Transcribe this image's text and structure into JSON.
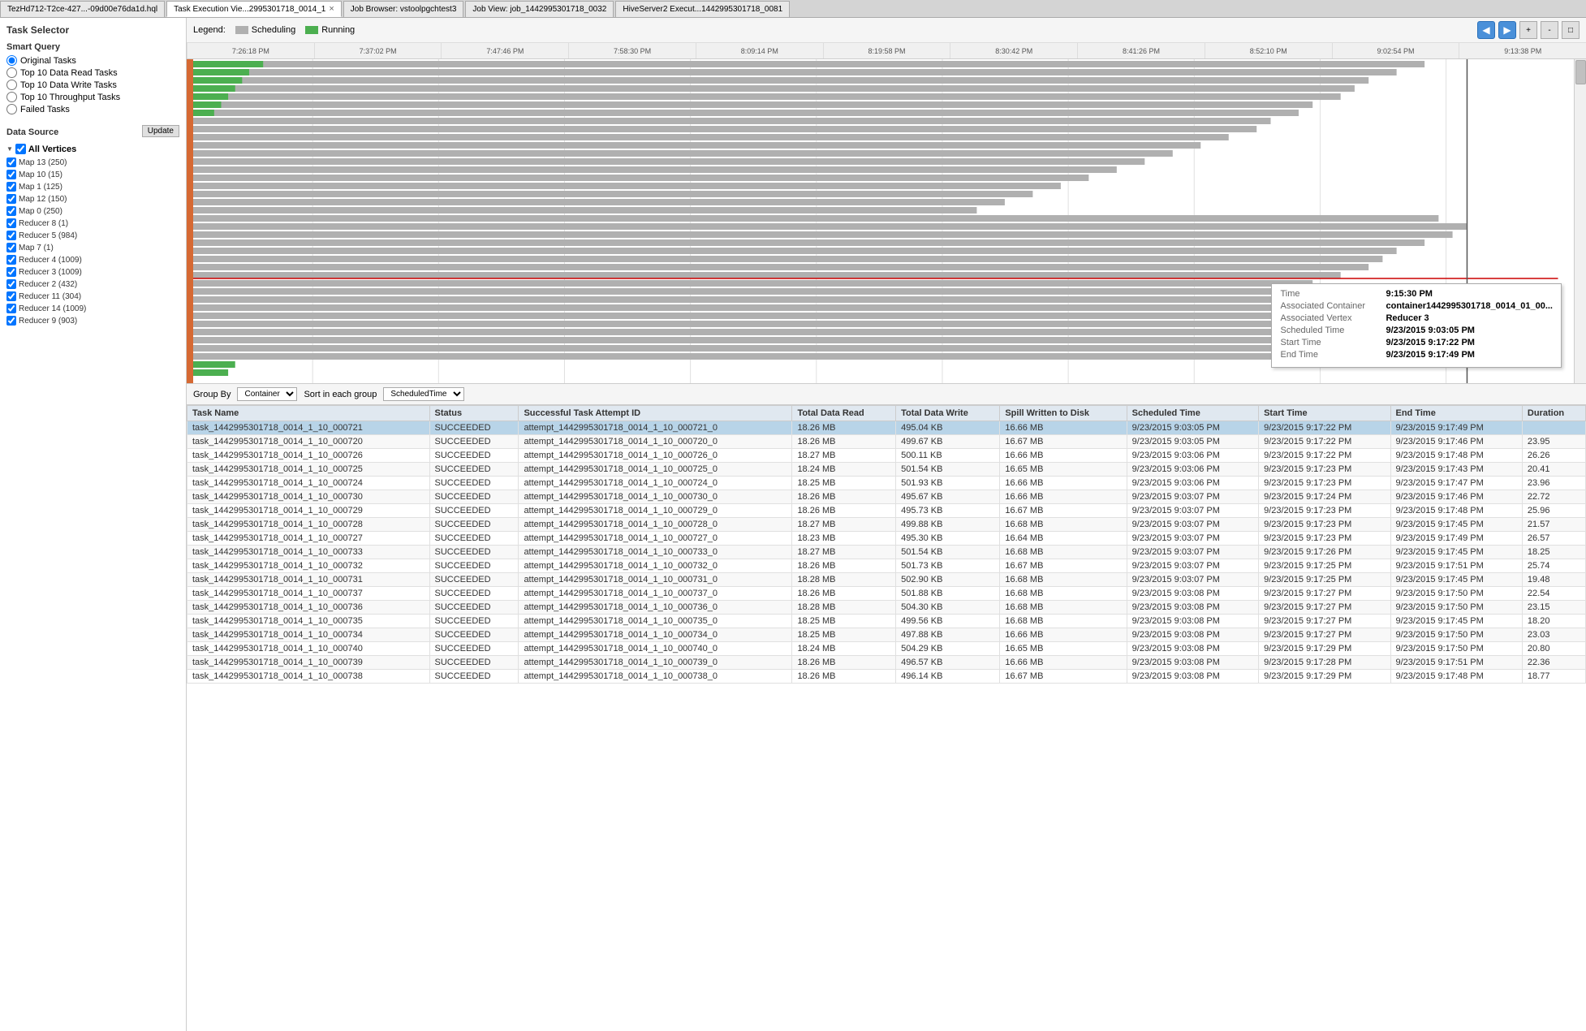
{
  "tabs": [
    {
      "id": "tab1",
      "label": "TezHd712-T2ce-427...-09d00e76da1d.hql",
      "active": false,
      "closable": false
    },
    {
      "id": "tab2",
      "label": "Task Execution Vie...2995301718_0014_1",
      "active": true,
      "closable": true
    },
    {
      "id": "tab3",
      "label": "Job Browser: vstoolpgchtest3",
      "active": false,
      "closable": false
    },
    {
      "id": "tab4",
      "label": "Job View: job_1442995301718_0032",
      "active": false,
      "closable": false
    },
    {
      "id": "tab5",
      "label": "HiveServer2 Execut...1442995301718_0081",
      "active": false,
      "closable": false
    }
  ],
  "sidebar": {
    "title": "Task Selector",
    "smart_query_label": "Smart Query",
    "options": [
      {
        "id": "opt1",
        "label": "Original Tasks",
        "selected": true
      },
      {
        "id": "opt2",
        "label": "Top 10 Data Read Tasks",
        "selected": false
      },
      {
        "id": "opt3",
        "label": "Top 10 Data Write Tasks",
        "selected": false
      },
      {
        "id": "opt4",
        "label": "Top 10 Throughput Tasks",
        "selected": false
      },
      {
        "id": "opt5",
        "label": "Failed Tasks",
        "selected": false
      }
    ],
    "data_source_label": "Data Source",
    "update_btn": "Update",
    "all_vertices_label": "All Vertices",
    "vertices": [
      {
        "label": "Map 13 (250)",
        "checked": true
      },
      {
        "label": "Map 10 (15)",
        "checked": true
      },
      {
        "label": "Map 1 (125)",
        "checked": true
      },
      {
        "label": "Map 12 (150)",
        "checked": true
      },
      {
        "label": "Map 0 (250)",
        "checked": true
      },
      {
        "label": "Reducer 8 (1)",
        "checked": true
      },
      {
        "label": "Reducer 5 (984)",
        "checked": true
      },
      {
        "label": "Map 7 (1)",
        "checked": true
      },
      {
        "label": "Reducer 4 (1009)",
        "checked": true
      },
      {
        "label": "Reducer 3 (1009)",
        "checked": true
      },
      {
        "label": "Reducer 2 (432)",
        "checked": true
      },
      {
        "label": "Reducer 11 (304)",
        "checked": true
      },
      {
        "label": "Reducer 14 (1009)",
        "checked": true
      },
      {
        "label": "Reducer 9 (903)",
        "checked": true
      }
    ]
  },
  "legend": {
    "label": "Legend:",
    "items": [
      {
        "label": "Scheduling",
        "type": "scheduling"
      },
      {
        "label": "Running",
        "type": "running"
      }
    ]
  },
  "time_labels": [
    "7:26:18 PM",
    "7:37:02 PM",
    "7:47:46 PM",
    "7:58:30 PM",
    "8:09:14 PM",
    "8:19:58 PM",
    "8:30:42 PM",
    "8:41:26 PM",
    "8:52:10 PM",
    "9:02:54 PM",
    "9:13:38 PM"
  ],
  "controls": {
    "group_by_label": "Group By",
    "group_by_value": "Container",
    "sort_label": "Sort in each group",
    "sort_value": "ScheduledTime"
  },
  "tooltip": {
    "time_label": "Time",
    "time_value": "9:15:30 PM",
    "container_label": "Associated Container",
    "container_value": "container1442995301718_0014_01_00...",
    "vertex_label": "Associated Vertex",
    "vertex_value": "Reducer 3",
    "scheduled_label": "Scheduled Time",
    "scheduled_value": "9/23/2015 9:03:05 PM",
    "start_label": "Start Time",
    "start_value": "9/23/2015 9:17:22 PM",
    "end_label": "End Time",
    "end_value": "9/23/2015 9:17:49 PM"
  },
  "table": {
    "headers": [
      "Task Name",
      "Status",
      "Successful Task Attempt ID",
      "Total Data Read",
      "Total Data Write",
      "Spill Written to Disk",
      "Scheduled Time",
      "Start Time",
      "End Time",
      "Duration"
    ],
    "rows": [
      {
        "selected": true,
        "task_name": "task_1442995301718_0014_1_10_000721",
        "status": "SUCCEEDED",
        "attempt_id": "attempt_1442995301718_0014_1_10_000721_0",
        "data_read": "18.26 MB",
        "data_write": "495.04 KB",
        "spill": "16.66 MB",
        "scheduled": "9/23/2015 9:03:05 PM",
        "start": "9/23/2015 9:17:22 PM",
        "end": "9/23/2015 9:17:49 PM",
        "duration": ""
      },
      {
        "selected": false,
        "task_name": "task_1442995301718_0014_1_10_000720",
        "status": "SUCCEEDED",
        "attempt_id": "attempt_1442995301718_0014_1_10_000720_0",
        "data_read": "18.26 MB",
        "data_write": "499.67 KB",
        "spill": "16.67 MB",
        "scheduled": "9/23/2015 9:03:05 PM",
        "start": "9/23/2015 9:17:22 PM",
        "end": "9/23/2015 9:17:46 PM",
        "duration": "23.95"
      },
      {
        "selected": false,
        "task_name": "task_1442995301718_0014_1_10_000726",
        "status": "SUCCEEDED",
        "attempt_id": "attempt_1442995301718_0014_1_10_000726_0",
        "data_read": "18.27 MB",
        "data_write": "500.11 KB",
        "spill": "16.66 MB",
        "scheduled": "9/23/2015 9:03:06 PM",
        "start": "9/23/2015 9:17:22 PM",
        "end": "9/23/2015 9:17:48 PM",
        "duration": "26.26"
      },
      {
        "selected": false,
        "task_name": "task_1442995301718_0014_1_10_000725",
        "status": "SUCCEEDED",
        "attempt_id": "attempt_1442995301718_0014_1_10_000725_0",
        "data_read": "18.24 MB",
        "data_write": "501.54 KB",
        "spill": "16.65 MB",
        "scheduled": "9/23/2015 9:03:06 PM",
        "start": "9/23/2015 9:17:23 PM",
        "end": "9/23/2015 9:17:43 PM",
        "duration": "20.41"
      },
      {
        "selected": false,
        "task_name": "task_1442995301718_0014_1_10_000724",
        "status": "SUCCEEDED",
        "attempt_id": "attempt_1442995301718_0014_1_10_000724_0",
        "data_read": "18.25 MB",
        "data_write": "501.93 KB",
        "spill": "16.66 MB",
        "scheduled": "9/23/2015 9:03:06 PM",
        "start": "9/23/2015 9:17:23 PM",
        "end": "9/23/2015 9:17:47 PM",
        "duration": "23.96"
      },
      {
        "selected": false,
        "task_name": "task_1442995301718_0014_1_10_000730",
        "status": "SUCCEEDED",
        "attempt_id": "attempt_1442995301718_0014_1_10_000730_0",
        "data_read": "18.26 MB",
        "data_write": "495.67 KB",
        "spill": "16.66 MB",
        "scheduled": "9/23/2015 9:03:07 PM",
        "start": "9/23/2015 9:17:24 PM",
        "end": "9/23/2015 9:17:46 PM",
        "duration": "22.72"
      },
      {
        "selected": false,
        "task_name": "task_1442995301718_0014_1_10_000729",
        "status": "SUCCEEDED",
        "attempt_id": "attempt_1442995301718_0014_1_10_000729_0",
        "data_read": "18.26 MB",
        "data_write": "495.73 KB",
        "spill": "16.67 MB",
        "scheduled": "9/23/2015 9:03:07 PM",
        "start": "9/23/2015 9:17:23 PM",
        "end": "9/23/2015 9:17:48 PM",
        "duration": "25.96"
      },
      {
        "selected": false,
        "task_name": "task_1442995301718_0014_1_10_000728",
        "status": "SUCCEEDED",
        "attempt_id": "attempt_1442995301718_0014_1_10_000728_0",
        "data_read": "18.27 MB",
        "data_write": "499.88 KB",
        "spill": "16.68 MB",
        "scheduled": "9/23/2015 9:03:07 PM",
        "start": "9/23/2015 9:17:23 PM",
        "end": "9/23/2015 9:17:45 PM",
        "duration": "21.57"
      },
      {
        "selected": false,
        "task_name": "task_1442995301718_0014_1_10_000727",
        "status": "SUCCEEDED",
        "attempt_id": "attempt_1442995301718_0014_1_10_000727_0",
        "data_read": "18.23 MB",
        "data_write": "495.30 KB",
        "spill": "16.64 MB",
        "scheduled": "9/23/2015 9:03:07 PM",
        "start": "9/23/2015 9:17:23 PM",
        "end": "9/23/2015 9:17:49 PM",
        "duration": "26.57"
      },
      {
        "selected": false,
        "task_name": "task_1442995301718_0014_1_10_000733",
        "status": "SUCCEEDED",
        "attempt_id": "attempt_1442995301718_0014_1_10_000733_0",
        "data_read": "18.27 MB",
        "data_write": "501.54 KB",
        "spill": "16.68 MB",
        "scheduled": "9/23/2015 9:03:07 PM",
        "start": "9/23/2015 9:17:26 PM",
        "end": "9/23/2015 9:17:45 PM",
        "duration": "18.25"
      },
      {
        "selected": false,
        "task_name": "task_1442995301718_0014_1_10_000732",
        "status": "SUCCEEDED",
        "attempt_id": "attempt_1442995301718_0014_1_10_000732_0",
        "data_read": "18.26 MB",
        "data_write": "501.73 KB",
        "spill": "16.67 MB",
        "scheduled": "9/23/2015 9:03:07 PM",
        "start": "9/23/2015 9:17:25 PM",
        "end": "9/23/2015 9:17:51 PM",
        "duration": "25.74"
      },
      {
        "selected": false,
        "task_name": "task_1442995301718_0014_1_10_000731",
        "status": "SUCCEEDED",
        "attempt_id": "attempt_1442995301718_0014_1_10_000731_0",
        "data_read": "18.28 MB",
        "data_write": "502.90 KB",
        "spill": "16.68 MB",
        "scheduled": "9/23/2015 9:03:07 PM",
        "start": "9/23/2015 9:17:25 PM",
        "end": "9/23/2015 9:17:45 PM",
        "duration": "19.48"
      },
      {
        "selected": false,
        "task_name": "task_1442995301718_0014_1_10_000737",
        "status": "SUCCEEDED",
        "attempt_id": "attempt_1442995301718_0014_1_10_000737_0",
        "data_read": "18.26 MB",
        "data_write": "501.88 KB",
        "spill": "16.68 MB",
        "scheduled": "9/23/2015 9:03:08 PM",
        "start": "9/23/2015 9:17:27 PM",
        "end": "9/23/2015 9:17:50 PM",
        "duration": "22.54"
      },
      {
        "selected": false,
        "task_name": "task_1442995301718_0014_1_10_000736",
        "status": "SUCCEEDED",
        "attempt_id": "attempt_1442995301718_0014_1_10_000736_0",
        "data_read": "18.28 MB",
        "data_write": "504.30 KB",
        "spill": "16.68 MB",
        "scheduled": "9/23/2015 9:03:08 PM",
        "start": "9/23/2015 9:17:27 PM",
        "end": "9/23/2015 9:17:50 PM",
        "duration": "23.15"
      },
      {
        "selected": false,
        "task_name": "task_1442995301718_0014_1_10_000735",
        "status": "SUCCEEDED",
        "attempt_id": "attempt_1442995301718_0014_1_10_000735_0",
        "data_read": "18.25 MB",
        "data_write": "499.56 KB",
        "spill": "16.68 MB",
        "scheduled": "9/23/2015 9:03:08 PM",
        "start": "9/23/2015 9:17:27 PM",
        "end": "9/23/2015 9:17:45 PM",
        "duration": "18.20"
      },
      {
        "selected": false,
        "task_name": "task_1442995301718_0014_1_10_000734",
        "status": "SUCCEEDED",
        "attempt_id": "attempt_1442995301718_0014_1_10_000734_0",
        "data_read": "18.25 MB",
        "data_write": "497.88 KB",
        "spill": "16.66 MB",
        "scheduled": "9/23/2015 9:03:08 PM",
        "start": "9/23/2015 9:17:27 PM",
        "end": "9/23/2015 9:17:50 PM",
        "duration": "23.03"
      },
      {
        "selected": false,
        "task_name": "task_1442995301718_0014_1_10_000740",
        "status": "SUCCEEDED",
        "attempt_id": "attempt_1442995301718_0014_1_10_000740_0",
        "data_read": "18.24 MB",
        "data_write": "504.29 KB",
        "spill": "16.65 MB",
        "scheduled": "9/23/2015 9:03:08 PM",
        "start": "9/23/2015 9:17:29 PM",
        "end": "9/23/2015 9:17:50 PM",
        "duration": "20.80"
      },
      {
        "selected": false,
        "task_name": "task_1442995301718_0014_1_10_000739",
        "status": "SUCCEEDED",
        "attempt_id": "attempt_1442995301718_0014_1_10_000739_0",
        "data_read": "18.26 MB",
        "data_write": "496.57 KB",
        "spill": "16.66 MB",
        "scheduled": "9/23/2015 9:03:08 PM",
        "start": "9/23/2015 9:17:28 PM",
        "end": "9/23/2015 9:17:51 PM",
        "duration": "22.36"
      },
      {
        "selected": false,
        "task_name": "task_1442995301718_0014_1_10_000738",
        "status": "SUCCEEDED",
        "attempt_id": "attempt_1442995301718_0014_1_10_000738_0",
        "data_read": "18.26 MB",
        "data_write": "496.14 KB",
        "spill": "16.67 MB",
        "scheduled": "9/23/2015 9:03:08 PM",
        "start": "9/23/2015 9:17:29 PM",
        "end": "9/23/2015 9:17:48 PM",
        "duration": "18.77"
      }
    ]
  }
}
